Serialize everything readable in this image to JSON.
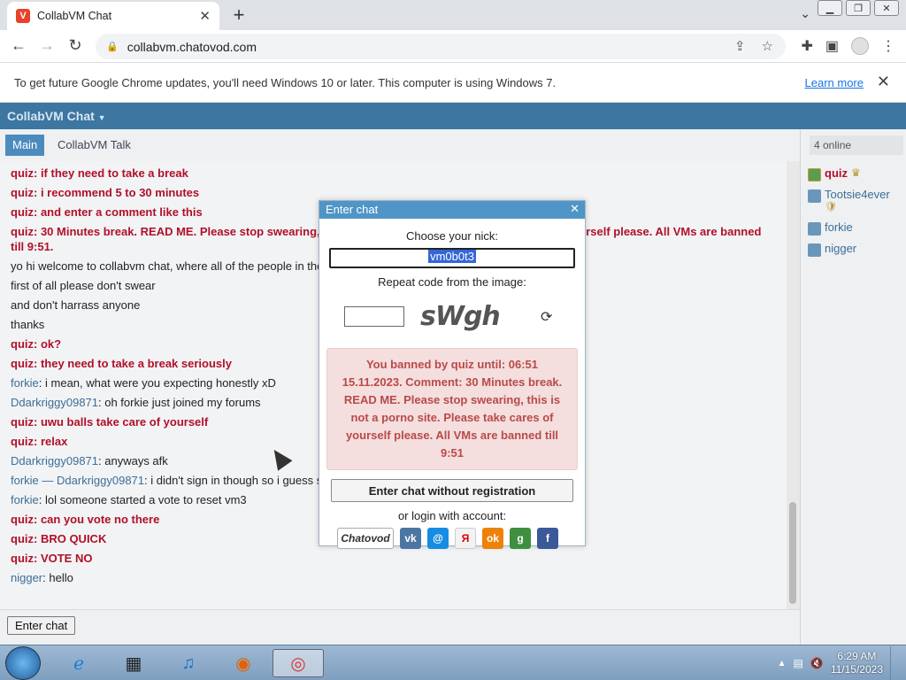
{
  "browser": {
    "tab_title": "CollabVM Chat",
    "tab_favicon_letter": "V",
    "url": "collabvm.chatovod.com",
    "infobar_text": "To get future Google Chrome updates, you'll need Windows 10 or later. This computer is using Windows 7.",
    "infobar_link": "Learn more"
  },
  "app": {
    "title": "CollabVM Chat",
    "tabs": [
      "Main",
      "CollabVM Talk"
    ],
    "online_label": "4 online",
    "enter_chat_label": "Enter chat"
  },
  "messages": [
    {
      "nick": "quiz",
      "text": ": if they need to take a break",
      "style": "bold"
    },
    {
      "nick": "quiz",
      "text": ": i recommend 5 to 30 minutes",
      "style": "bold"
    },
    {
      "nick": "quiz",
      "text": ": and enter a comment like this",
      "style": "bold"
    },
    {
      "nick": "quiz",
      "text": ": 30 Minutes break. READ ME. Please stop swearing, this is not a porno site. Please take cares of yourself please. All VMs are banned till 9:51.",
      "style": "bold"
    },
    {
      "nick": "",
      "text": "yo hi welcome to collabvm chat, where all of the people in the",
      "style": "dark"
    },
    {
      "nick": "",
      "text": "first of all please don't swear",
      "style": "dark"
    },
    {
      "nick": "",
      "text": "and don't harrass anyone",
      "style": "dark"
    },
    {
      "nick": "",
      "text": "thanks",
      "style": "dark"
    },
    {
      "nick": "quiz",
      "text": ": ok?",
      "style": "bold"
    },
    {
      "nick": "quiz",
      "text": ": they need to take a break seriously",
      "style": "bold"
    },
    {
      "nick": "forkie",
      "text": ": i mean, what were you expecting honestly xD",
      "style": "plain"
    },
    {
      "nick": "Ddarkriggy09871",
      "text": ": oh forkie just joined my forums",
      "style": "plain"
    },
    {
      "nick": "quiz",
      "text": ": uwu balls take care of yourself",
      "style": "bold"
    },
    {
      "nick": "quiz",
      "text": ": relax",
      "style": "bold"
    },
    {
      "nick": "Ddarkriggy09871",
      "text": ": anyways afk",
      "style": "plain"
    },
    {
      "nick": "forkie — Ddarkriggy09871",
      "text": ": i didn't sign in though so i guess s",
      "style": "plain"
    },
    {
      "nick": "forkie",
      "text": ": lol someone started a vote to reset vm3",
      "style": "plain"
    },
    {
      "nick": "quiz",
      "text": ": can you vote no there",
      "style": "bold"
    },
    {
      "nick": "quiz",
      "text": ": BRO QUICK",
      "style": "bold"
    },
    {
      "nick": "quiz",
      "text": ": VOTE NO",
      "style": "bold"
    },
    {
      "nick": "nigger",
      "text": ": hello",
      "style": "plain"
    }
  ],
  "users": [
    {
      "name": "quiz",
      "mod": true,
      "badge": "♛"
    },
    {
      "name": "Tootsie4ever",
      "mod": false,
      "badge": "🛡"
    },
    {
      "name": "forkie",
      "mod": false,
      "badge": ""
    },
    {
      "name": "nigger",
      "mod": false,
      "badge": ""
    }
  ],
  "dialog": {
    "title": "Enter chat",
    "nick_label": "Choose your nick:",
    "nick_value": "vm0b0t3",
    "captcha_label": "Repeat code from the image:",
    "captcha_text": "sWgh",
    "ban_message": "You banned by quiz until: 06:51 15.11.2023. Comment: 30 Minutes break. READ ME. Please stop swearing, this is not a porno site. Please take cares of yourself please. All VMs are banned till 9:51",
    "guest_button": "Enter chat without registration",
    "or_login": "or login with account:",
    "providers": [
      {
        "name": "Chatovod",
        "color": "#ffffff"
      },
      {
        "name": "VK",
        "label": "vk",
        "color": "#4c75a3"
      },
      {
        "name": "Mail.ru",
        "label": "@",
        "color": "#168de2"
      },
      {
        "name": "Yandex",
        "label": "Я",
        "color": "#f2f2f2"
      },
      {
        "name": "Odnoklassniki",
        "label": "ok",
        "color": "#ee8208"
      },
      {
        "name": "Google",
        "label": "g",
        "color": "#3f8f3f"
      },
      {
        "name": "Facebook",
        "label": "f",
        "color": "#3b5998"
      }
    ]
  },
  "taskbar": {
    "time": "6:29 AM",
    "date": "11/15/2023"
  }
}
